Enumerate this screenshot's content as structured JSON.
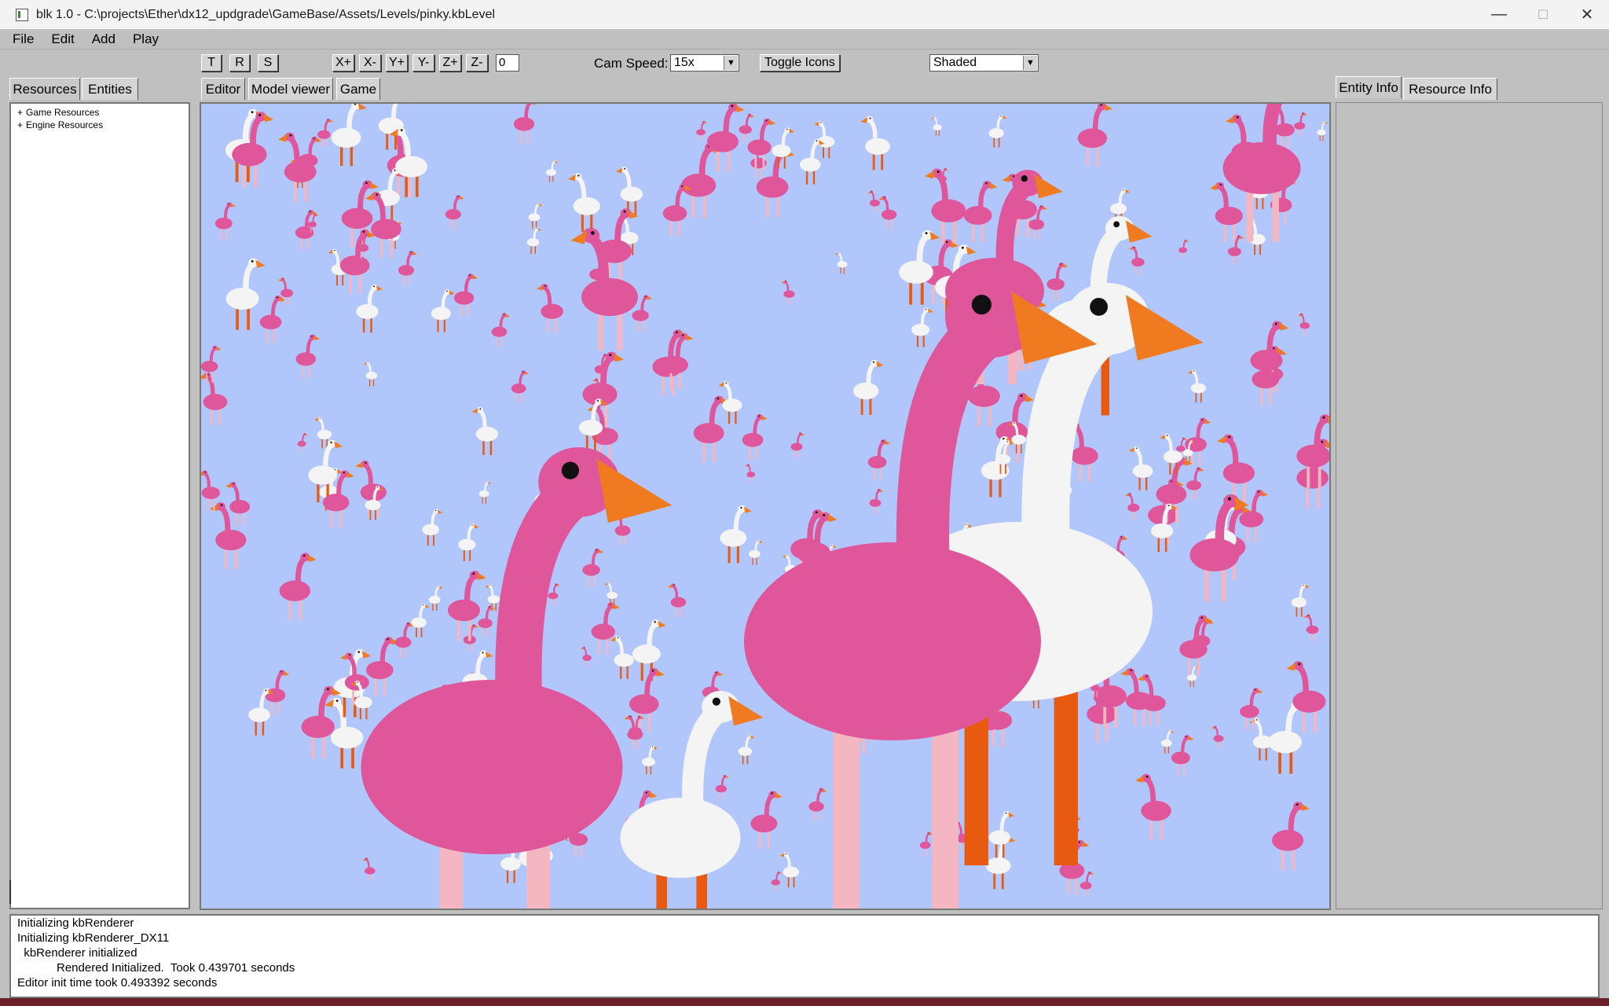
{
  "window": {
    "title": "blk 1.0  - C:\\projects\\Ether\\dx12_updgrade\\GameBase/Assets/Levels/pinky.kbLevel",
    "minimize": "—",
    "maximize": "☐",
    "close": "✕"
  },
  "menu": [
    "File",
    "Edit",
    "Add",
    "Play"
  ],
  "toolbar": {
    "transform_buttons": [
      "T",
      "R",
      "S"
    ],
    "axis_buttons": [
      "X+",
      "X-",
      "Y+",
      "Y-",
      "Z+",
      "Z-"
    ],
    "axis_value": "0",
    "cam_speed_label": "Cam Speed:",
    "cam_speed_value": "15x",
    "toggle_icons": "Toggle Icons",
    "render_mode": "Shaded"
  },
  "left_tabs": [
    "Resources",
    "Entities"
  ],
  "resource_tree": [
    "Game Resources",
    "Engine Resources"
  ],
  "center_tabs": [
    "Editor",
    "Model viewer",
    "Game"
  ],
  "right_tabs": [
    "Entity Info",
    "Resource Info"
  ],
  "console_lines": [
    "Initializing kbRenderer",
    "Initializing kbRenderer_DX11",
    "  kbRenderer initialized",
    "            Rendered Initialized.  Took 0.439701 seconds",
    "Editor init time took 0.493392 seconds"
  ],
  "colors": {
    "sky": "#b1c6fb",
    "flamingo_pink": "#e0569a",
    "beak_orange": "#f07a20",
    "leg_pink": "#f4b6c0",
    "leg_orange": "#e85a10",
    "goose_white": "#f4f4f4"
  }
}
